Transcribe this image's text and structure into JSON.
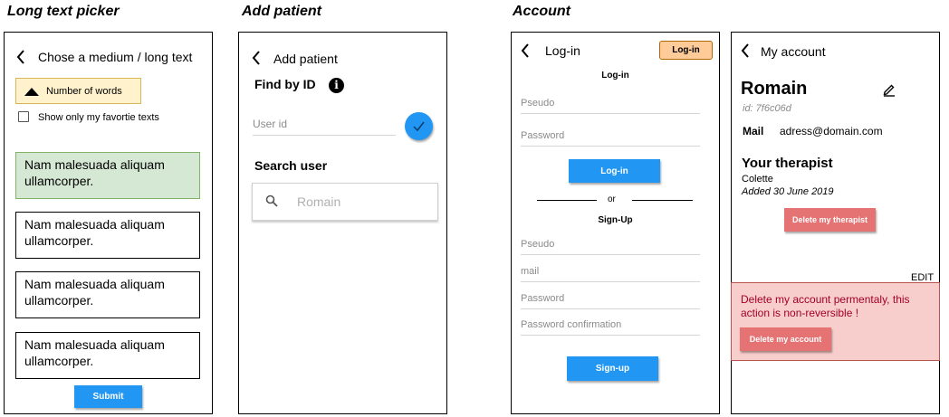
{
  "sections": {
    "picker_title": "Long text picker",
    "patient_title": "Add patient",
    "account_title": "Account"
  },
  "picker": {
    "header": "Chose a medium / long text",
    "sort_label": "Number of words",
    "favorite_label": "Show only my favortie texts",
    "cards": [
      "Nam malesuada aliquam ullamcorper.",
      "Nam malesuada aliquam ullamcorper.",
      "Nam malesuada aliquam ullamcorper.",
      "Nam malesuada aliquam ullamcorper."
    ],
    "submit": "Submit"
  },
  "add_patient": {
    "header": "Add patient",
    "find_by_id": "Find by ID",
    "user_id_placeholder": "User id",
    "search_user": "Search user",
    "search_placeholder": "Romain"
  },
  "login": {
    "header": "Log-in",
    "header_button": "Log-in",
    "login_heading": "Log-in",
    "pseudo": "Pseudo",
    "password": "Password",
    "login_button": "Log-in",
    "or": "or",
    "signup_heading": "Sign-Up",
    "signup_pseudo": "Pseudo",
    "signup_mail": "mail",
    "signup_password": "Password",
    "signup_password_confirm": "Password confirmation",
    "signup_button": "Sign-up"
  },
  "my_account": {
    "header": "My account",
    "name": "Romain",
    "user_id": "id: 7f6c06d",
    "mail_label": "Mail",
    "mail_value": "adress@domain.com",
    "therapist_heading": "Your therapist",
    "therapist_name": "Colette",
    "therapist_added": "Added 30 June 2019",
    "delete_therapist": "Delete my therapist",
    "edit_label": "EDIT",
    "delete_warning": "Delete my account permentaly, this action is non-reversible !",
    "delete_account": "Delete my account"
  },
  "colors": {
    "accent_blue": "#2196f3",
    "danger_red": "#e57373",
    "selected_green": "#d5e8d4",
    "sort_yellow": "#fff2cc",
    "header_btn_orange": "#ffcc99",
    "danger_bg": "#f8cecc"
  },
  "icons": [
    "back-chevron-icon",
    "sort-up-icon",
    "info-icon",
    "check-icon",
    "search-icon",
    "edit-pencil-icon"
  ]
}
